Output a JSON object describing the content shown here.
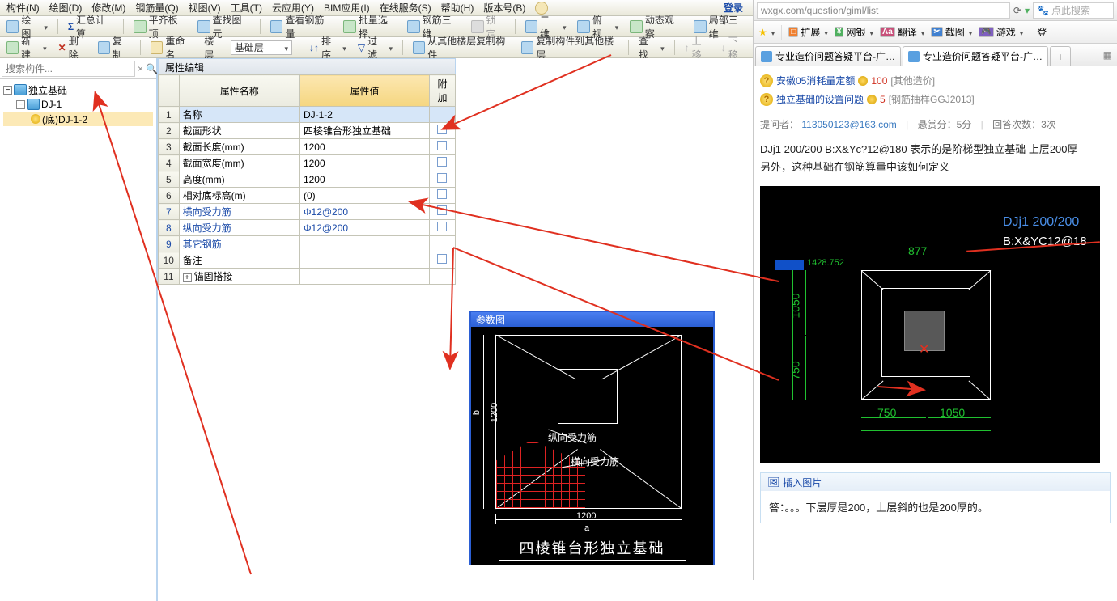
{
  "menubar": {
    "items": [
      "构件(N)",
      "绘图(D)",
      "修改(M)",
      "钢筋量(Q)",
      "视图(V)",
      "工具(T)",
      "云应用(Y)",
      "BIM应用(I)",
      "在线服务(S)",
      "帮助(H)",
      "版本号(B)"
    ],
    "login": "登录"
  },
  "toolbar1": {
    "draw": "绘图",
    "sum": "汇总计算",
    "flat": "平齐板顶",
    "findg": "查找图元",
    "findr": "查看钢筋量",
    "batch": "批量选择",
    "r3d": "钢筋三维",
    "lock": "锁定",
    "d2": "二维",
    "bird": "俯视",
    "dyn": "动态观察",
    "loc3d": "局部三维"
  },
  "toolbar2": {
    "new": "新建",
    "del": "删除",
    "copy": "复制",
    "rename": "重命名",
    "floor": "楼层",
    "flval": "基础层",
    "sort": "排序",
    "filter": "过滤",
    "copyfrom": "从其他楼层复制构件",
    "copyto": "复制构件到其他楼层",
    "find": "查找",
    "up": "上移",
    "down": "下移"
  },
  "search_placeholder": "搜索构件...",
  "tree": {
    "n1": "独立基础",
    "n2": "DJ-1",
    "n3": "(底)DJ-1-2"
  },
  "propsTitle": "属性编辑",
  "propsHeader": {
    "name": "属性名称",
    "value": "属性值",
    "extra": "附加"
  },
  "props": [
    {
      "n": "1",
      "name": "名称",
      "val": "DJ-1-2",
      "hl": true
    },
    {
      "n": "2",
      "name": "截面形状",
      "val": "四棱锥台形独立基础",
      "chk": true
    },
    {
      "n": "3",
      "name": "截面长度(mm)",
      "val": "1200",
      "chk": true
    },
    {
      "n": "4",
      "name": "截面宽度(mm)",
      "val": "1200",
      "chk": true
    },
    {
      "n": "5",
      "name": "高度(mm)",
      "val": "1200",
      "chk": true
    },
    {
      "n": "6",
      "name": "相对底标高(m)",
      "val": "(0)",
      "chk": true
    },
    {
      "n": "7",
      "name": "横向受力筋",
      "val": "Φ12@200",
      "blue": true,
      "chk": true
    },
    {
      "n": "8",
      "name": "纵向受力筋",
      "val": "Φ12@200",
      "blue": true,
      "chk": true
    },
    {
      "n": "9",
      "name": "其它钢筋",
      "val": "",
      "blue": true
    },
    {
      "n": "10",
      "name": "备注",
      "val": "",
      "chk": true
    },
    {
      "n": "11",
      "name": "锚固搭接",
      "val": "",
      "exp": true
    }
  ],
  "paramfig": {
    "title": "参数图",
    "lbl_v": "纵向受力筋",
    "lbl_h": "横向受力筋",
    "dim_w": "1200",
    "dim_h": "1200",
    "axis_a": "a",
    "axis_b": "b",
    "caption": "四棱锥台形独立基础"
  },
  "browser": {
    "url": "wxgx.com/question/giml/list",
    "search_ph": "点此搜索",
    "tbitems": {
      "fav": "收藏",
      "ext": "扩展",
      "bank": "网银",
      "trans": "翻译",
      "shot": "截图",
      "game": "游戏",
      "login": "登"
    },
    "tab1": "专业造价问题答疑平台-广…",
    "tab2": "专业造价问题答疑平台-广…",
    "q1": {
      "title": "安徽05消耗量定额",
      "pts": "100",
      "cat": "[其他造价]"
    },
    "q2": {
      "title": "独立基础的设置问题",
      "pts": "5",
      "cat": "[钢筋抽样GGJ2013]"
    },
    "meta": {
      "asker": "提问者：",
      "email": "113050123@163.com",
      "bounty": "悬赏分：5分",
      "replies": "回答次数：3次"
    },
    "body1": "DJj1 200/200  B:X&Yc?12@180  表示的是阶梯型独立基础  上层200厚",
    "body2": "另外，这种基础在钢筋算量中该如何定义",
    "cad": {
      "label1": "DJj1 200/200",
      "label2": "B:X&YC12@18",
      "d877": "877",
      "d1050a": "1050",
      "d750a": "750",
      "d750b": "750",
      "d1050b": "1050",
      "coord": "1428.752"
    },
    "insert": "插入图片",
    "answer": "答：。。。下层厚是200，上层斜的也是200厚的。"
  }
}
